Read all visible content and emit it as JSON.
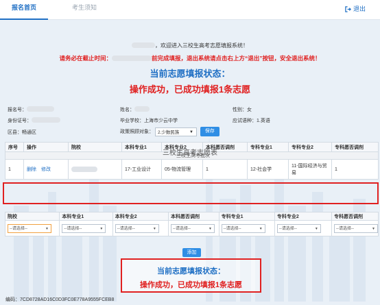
{
  "tabs": [
    {
      "label": "报名首页",
      "active": true
    },
    {
      "label": "考生须知",
      "active": false
    }
  ],
  "logout_label": "退出",
  "welcome_text": "，欢迎进入三校生高考志愿填报系统！",
  "warning": {
    "prefix": "请务必在截止时间：",
    "suffix": "前完成填报，退出系统请点击右上方“退出”按钮，安全退出系统！"
  },
  "status_title": "当前志愿填报状态：",
  "status_message": "操作成功，已成功填报1条志愿",
  "info": {
    "reg_no_label": "报名号：",
    "name_label": "姓名：",
    "gender_label": "性别：",
    "gender_value": "女",
    "id_label": "身份证号：",
    "school_label": "毕业学校：",
    "school_value": "上海市少云中学",
    "language_label": "应试语种：",
    "language_value": "1.英语",
    "district_label": "区县：",
    "district_value": "畅通区",
    "policy_label": "政策照顾对象：",
    "policy_value": "2.少数民族",
    "save_label": "保存"
  },
  "table_title": "三校生高考志愿表",
  "table": {
    "headers": [
      "序号",
      "操作",
      "院校",
      "本科专业1",
      "本科专业2",
      "本科愿否调剂",
      "专科专业1",
      "专科专业2",
      "专科愿否调剂"
    ],
    "batch_label": "三校生高考批次",
    "row": {
      "index": "1",
      "delete_label": "删除",
      "edit_label": "修改",
      "school": "",
      "bachelor_major1": "17-工业设计",
      "bachelor_major2": "05-物流管理",
      "bachelor_adjust": "1",
      "college_major1": "12-社会学",
      "college_major2": "11-国际经济与贸易",
      "college_adjust": "1"
    }
  },
  "add_form": {
    "headers": [
      "院校",
      "本科专业1",
      "本科专业2",
      "本科愿否调剂",
      "专科专业1",
      "专科专业2",
      "专科愿否调剂"
    ],
    "placeholder": "--请选择--"
  },
  "add_label": "添加",
  "code_label": "编码：",
  "code_value": "7CD8728AD16C0D3FC0E778A9555FCEB8",
  "colors": {
    "accent": "#1f6fc4",
    "alert": "#e02020",
    "button": "#2f8ee5"
  }
}
